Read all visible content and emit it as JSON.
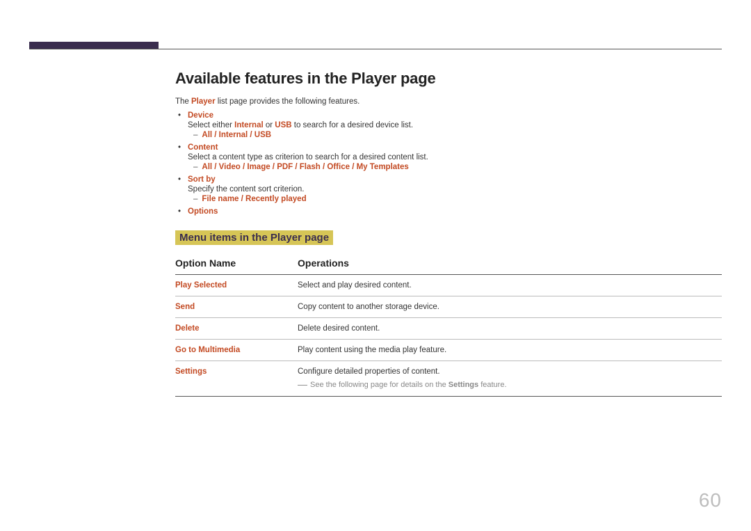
{
  "page_number": "60",
  "heading": "Available features in the Player page",
  "intro_pre": "The ",
  "intro_mid": "Player",
  "intro_post": " list page provides the following features.",
  "features": [
    {
      "title": "Device",
      "desc_pre": "Select either ",
      "desc_t1": "Internal",
      "desc_mid": " or ",
      "desc_t2": "USB",
      "desc_post": " to search for a desired device list.",
      "sub": "All / Internal / USB"
    },
    {
      "title": "Content",
      "desc_plain": "Select a content type as criterion to search for a desired content list.",
      "sub": "All / Video / Image / PDF / Flash / Office / My Templates"
    },
    {
      "title": "Sort by",
      "desc_plain": "Specify the content sort criterion.",
      "sub": "File name / Recently played"
    },
    {
      "title": "Options"
    }
  ],
  "subheading": "Menu items in the Player page",
  "table": {
    "col1": "Option Name",
    "col2": "Operations",
    "rows": [
      {
        "name": "Play Selected",
        "op": "Select and play desired content."
      },
      {
        "name": "Send",
        "op": "Copy content to another storage device."
      },
      {
        "name": "Delete",
        "op": "Delete desired content."
      },
      {
        "name": "Go to Multimedia",
        "op": "Play content using the media play feature."
      },
      {
        "name": "Settings",
        "op": "Configure detailed properties of content.",
        "note_pre": "See the following page for details on the ",
        "note_b": "Settings",
        "note_post": " feature."
      }
    ]
  }
}
